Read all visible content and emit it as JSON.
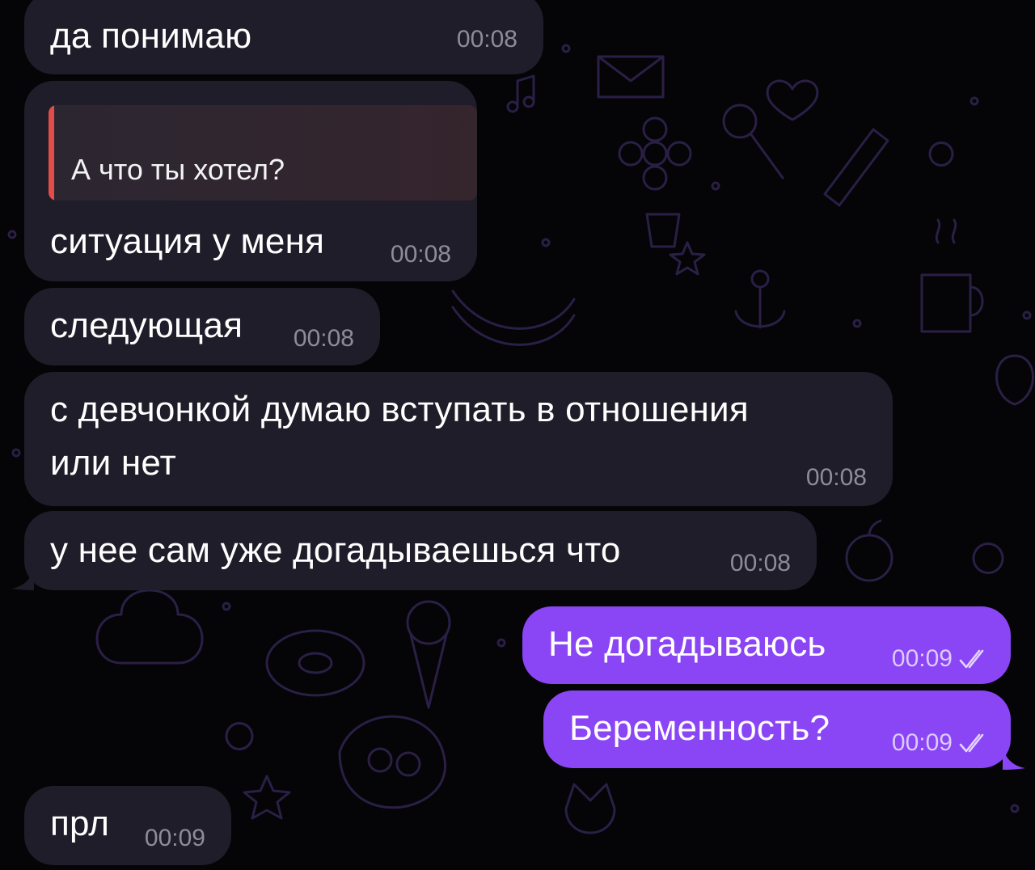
{
  "messages": [
    {
      "id": "m1",
      "direction": "incoming",
      "text": "да понимаю",
      "time": "00:08"
    },
    {
      "id": "m2",
      "direction": "incoming",
      "reply_quote": "А что ты хотел?",
      "text": "ситуация у меня",
      "time": "00:08"
    },
    {
      "id": "m3",
      "direction": "incoming",
      "text": "следующая",
      "time": "00:08"
    },
    {
      "id": "m4",
      "direction": "incoming",
      "text_lines": [
        "с девчонкой думаю вступать в отношения",
        "или нет"
      ],
      "time": "00:08"
    },
    {
      "id": "m5",
      "direction": "incoming",
      "text": "у нее сам уже догадываешься что",
      "time": "00:08"
    },
    {
      "id": "m6",
      "direction": "outgoing",
      "text": "Не догадываюсь",
      "time": "00:09",
      "status": "read",
      "status_icon": "double-check-icon"
    },
    {
      "id": "m7",
      "direction": "outgoing",
      "text": "Беременность?",
      "time": "00:09",
      "status": "read",
      "status_icon": "double-check-icon"
    },
    {
      "id": "m8",
      "direction": "incoming",
      "text": "прл",
      "time": "00:09"
    }
  ],
  "colors": {
    "background": "#050407",
    "incoming_bubble": "#1e1d29",
    "outgoing_bubble": "#8a45f4",
    "quote_accent": "#e24d4a",
    "wallpaper_doodle": "#2a1f45"
  }
}
